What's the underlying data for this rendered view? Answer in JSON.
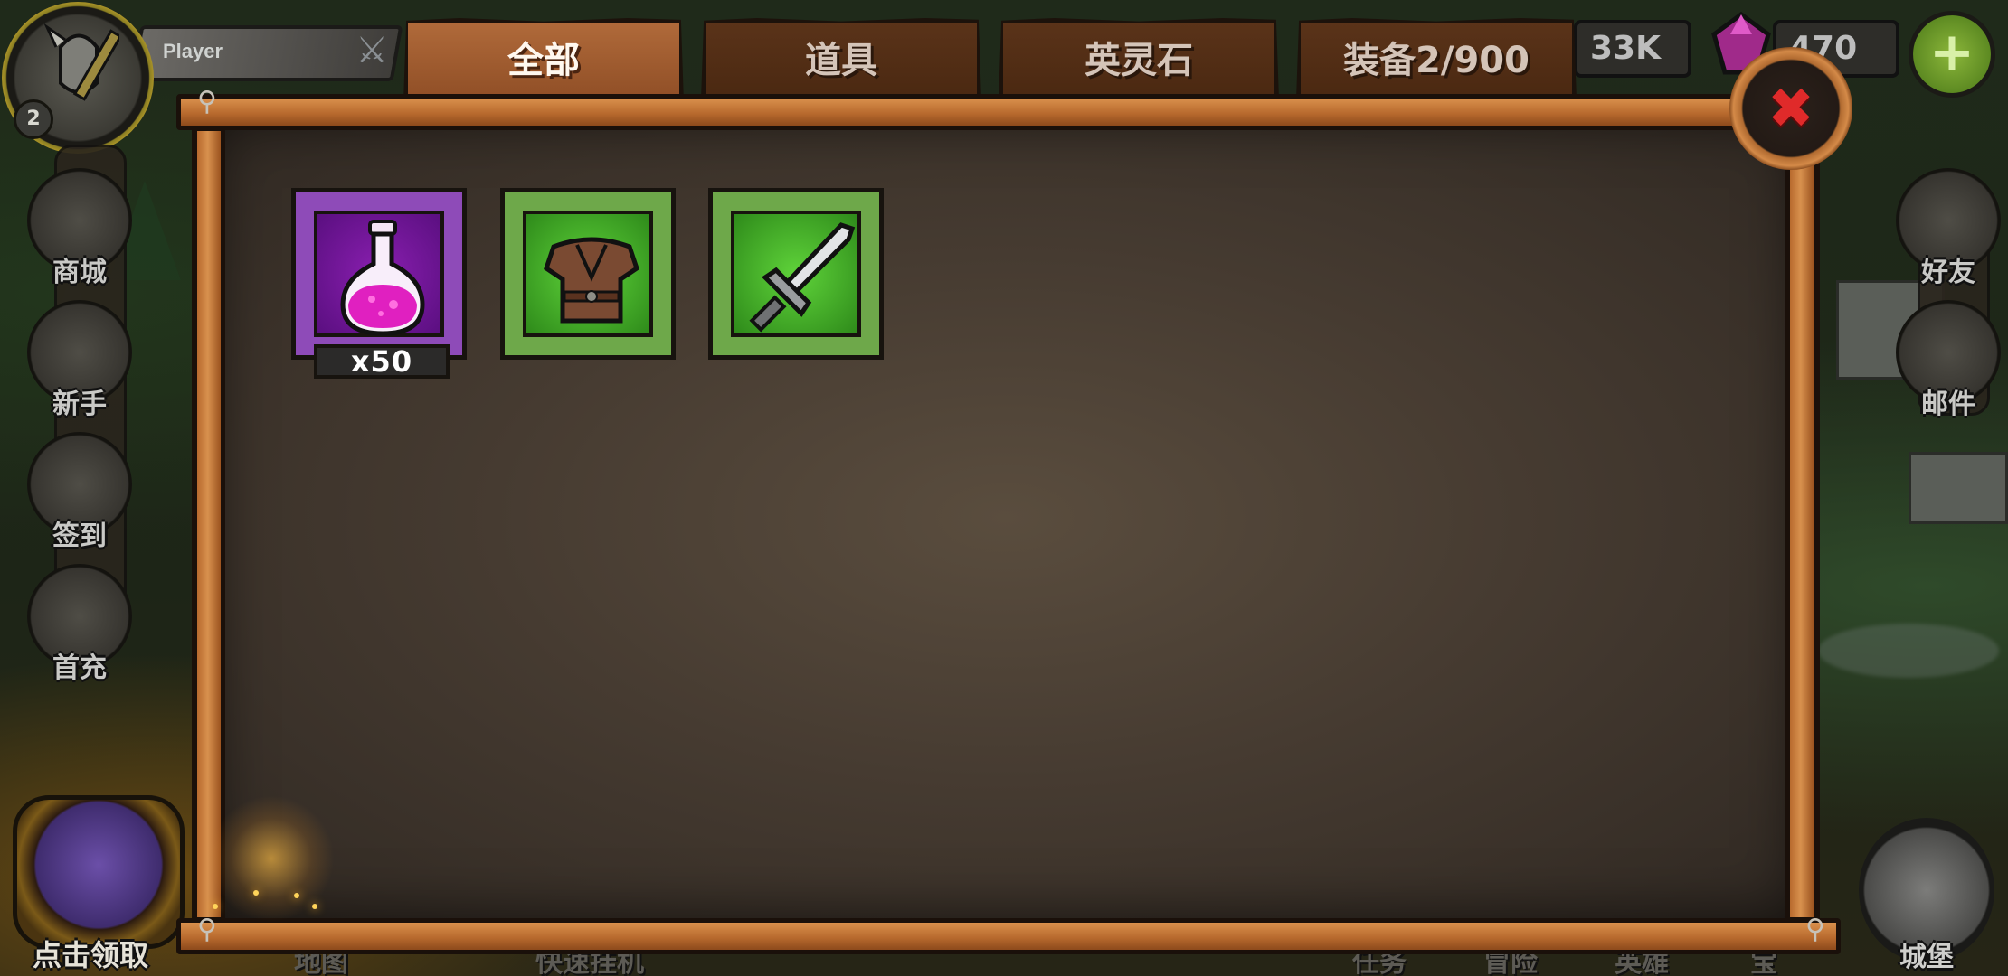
{
  "hud": {
    "player_name": "Player",
    "level": "2",
    "gold": "33K",
    "gems": "470",
    "plus_label": "+"
  },
  "left_menu": [
    {
      "label": "商城",
      "icon": "shop-icon"
    },
    {
      "label": "新手",
      "icon": "novice-icon"
    },
    {
      "label": "签到",
      "icon": "checkin-icon"
    },
    {
      "label": "首充",
      "icon": "first-recharge-icon"
    }
  ],
  "right_menu": [
    {
      "label": "好友",
      "icon": "friends-icon"
    },
    {
      "label": "邮件",
      "icon": "mail-icon"
    }
  ],
  "chest": {
    "label": "点击领取"
  },
  "castle": {
    "label": "城堡"
  },
  "bottom_nav_faded": [
    "地图",
    "快速挂机",
    "任务",
    "冒险",
    "英雄",
    "宝"
  ],
  "tabs": [
    {
      "label": "全部",
      "active": true
    },
    {
      "label": "道具",
      "active": false
    },
    {
      "label": "英灵石",
      "active": false
    },
    {
      "label": "装备2/900",
      "active": false
    }
  ],
  "close_label": "✖",
  "inventory": [
    {
      "name": "magenta-potion",
      "rarity": "purple",
      "quantity": "x50",
      "icon": "potion-icon"
    },
    {
      "name": "leather-armor",
      "rarity": "green",
      "quantity": "",
      "icon": "armor-icon"
    },
    {
      "name": "steel-sword",
      "rarity": "green",
      "quantity": "",
      "icon": "sword-icon"
    }
  ],
  "colors": {
    "frame_wood": "#c97a3a",
    "tab_active": "#a05a2e",
    "tab_inactive": "#4e2a14",
    "rarity_purple": "#8e4bb8",
    "rarity_green": "#6ea84a",
    "close_x": "#e02a2a"
  }
}
